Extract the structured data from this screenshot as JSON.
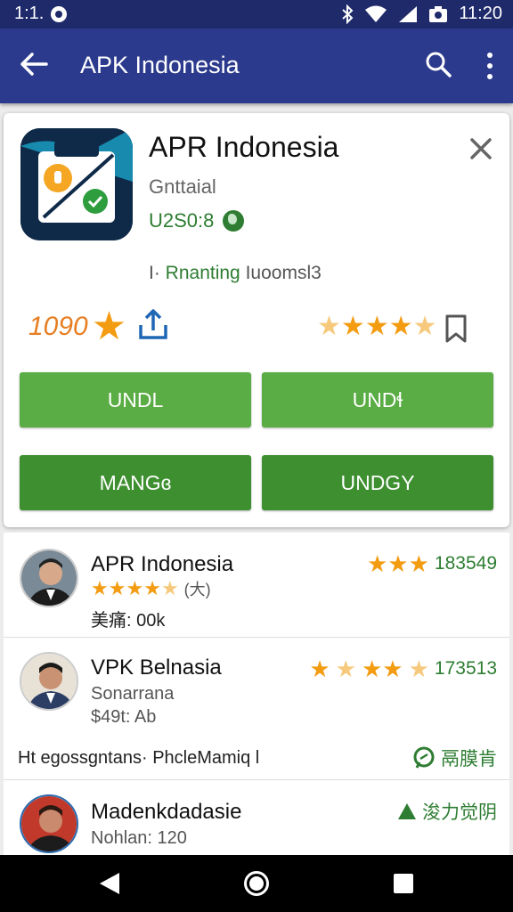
{
  "status_bar": {
    "left_text": "1:1.",
    "time": "11:20"
  },
  "app_bar": {
    "title": "APK Indonesia"
  },
  "app": {
    "name": "APR Indonesia",
    "developer": "Gnttaial",
    "price": "U2S0:8",
    "tagline_prefix": "I·",
    "tagline_green": "Rnanting",
    "tagline_rest": "Iuoomsl3",
    "rating_value": "1090",
    "rating_stars": 4.5
  },
  "buttons": {
    "b1": "UNDL",
    "b2": "UNDɬ",
    "b3": "MANGɞ",
    "b4": "UNDGY"
  },
  "list": [
    {
      "title": "APR Indonesia",
      "subtitle": "美痛: 00k",
      "extra": "(大)",
      "stars": 3,
      "count": "183549"
    },
    {
      "title": "VPK Belnasia",
      "subtitle": "Sonarrana",
      "subtitle2": "$49t: Ab",
      "stars": 3.5,
      "count": "173513",
      "footer": "Ht egossgntans· PhcleMamiq l",
      "footer_right": "鬲膜肯"
    },
    {
      "title": "Madenkdadasie",
      "subtitle": "Nohlan: 120",
      "right_text": "浚力觉阴"
    }
  ],
  "colors": {
    "appbar": "#2b3a8c",
    "statusbar": "#1f2a6b",
    "green_light": "#5aac44",
    "green_dark": "#3d8f2f",
    "star": "#f39c12"
  },
  "icons": [
    "back-arrow-icon",
    "search-icon",
    "more-vert-icon",
    "close-icon",
    "globe-icon",
    "share-icon",
    "bookmark-icon",
    "chat-icon",
    "trending-up-icon"
  ]
}
